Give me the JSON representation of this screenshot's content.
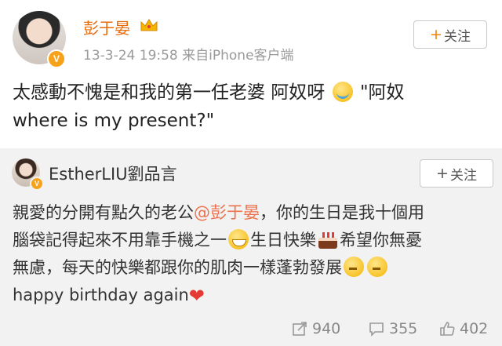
{
  "post": {
    "author": "彭于晏",
    "meta": "13-3-24 19:58  来自iPhone客户端",
    "follow_label": "关注",
    "text_part1": "太感動不愧是和我的第一任老婆 阿奴呀",
    "text_part2": "\"阿奴",
    "text_line2": "where is my present?\""
  },
  "repost": {
    "author": "EstherLIU劉品言",
    "follow_label": "关注",
    "text_a": "親愛的分開有點久的老公",
    "mention": "@彭于晏",
    "text_b": "，你的生日是我十個用",
    "text_c": "腦袋記得起來不用靠手機之一",
    "text_d": "生日快樂",
    "text_e": "希望你無憂",
    "text_f": "無慮，每天的快樂都跟你的肌肉一樣蓬勃發展",
    "text_g": "happy birthday again"
  },
  "actions": {
    "reposts": "940",
    "comments": "355",
    "likes": "402"
  },
  "colors": {
    "author_orange": "#e86b0c",
    "mention": "#eb7350",
    "repost_bg": "#f2f2f2"
  }
}
